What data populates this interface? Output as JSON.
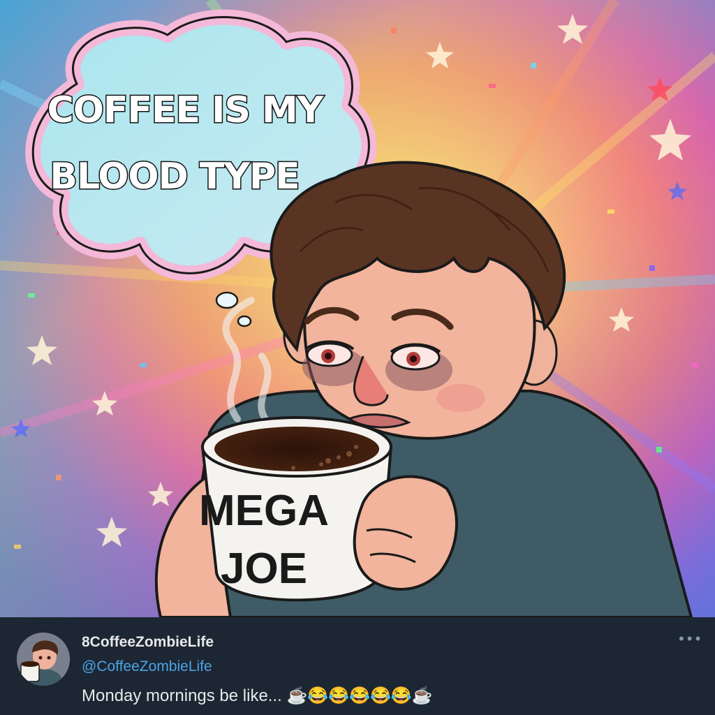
{
  "illustration": {
    "thought_bubble_line1": "COFFEE IS MY",
    "thought_bubble_line2": "BLOOD TYPE",
    "mug_line1": "MEGA",
    "mug_line2": "JOE"
  },
  "post": {
    "display_name": "8CoffeeZombieLife",
    "handle": "@CoffeeZombieLife",
    "text": "Monday mornings be like... ☕😂😂😂😂😂☕",
    "more_icon": "ellipsis-icon"
  },
  "colors": {
    "post_background": "#1c2733",
    "handle_color": "#4da3e8",
    "text_color": "#e7e9ea"
  }
}
